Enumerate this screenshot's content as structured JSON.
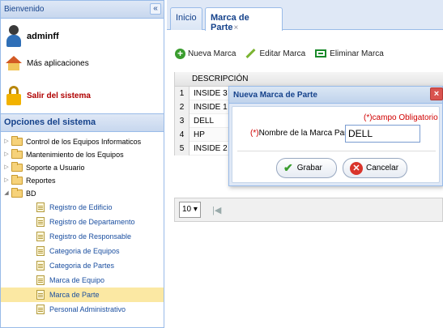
{
  "sidebar": {
    "welcome_title": "Bienvenido",
    "collapse_glyph": "«",
    "user": {
      "name": "adminff"
    },
    "more_apps": "Más aplicaciones",
    "logout": "Salir del sistema",
    "options_title": "Opciones del sistema",
    "folders": [
      "Control de los Equipos Informaticos",
      "Mantenimiento de los Equipos",
      "Soporte a Usuario",
      "Reportes",
      "BD"
    ],
    "bd_items": [
      "Registro de Edificio",
      "Registro de Departamento",
      "Registro de Responsable",
      "Categoria de Equipos",
      "Categoria de Partes",
      "Marca de Equipo",
      "Marca de Parte",
      "Personal Administrativo"
    ],
    "selected_item": "Marca de Parte"
  },
  "tabs": [
    {
      "label": "Inicio"
    },
    {
      "label": "Marca de Parte",
      "close": "×",
      "active": true
    }
  ],
  "toolbar": {
    "new_label": "Nueva Marca",
    "edit_label": "Editar Marca",
    "delete_label": "Eliminar Marca"
  },
  "grid": {
    "column": "DESCRIPCIÓN",
    "rows": [
      {
        "num": "1",
        "desc": "INSIDE 3"
      },
      {
        "num": "2",
        "desc": "INSIDE 1"
      },
      {
        "num": "3",
        "desc": "DELL"
      },
      {
        "num": "4",
        "desc": "HP"
      },
      {
        "num": "5",
        "desc": "INSIDE 2"
      }
    ],
    "page_size": "10 ▾"
  },
  "dialog": {
    "title": "Nueva Marca de Parte",
    "close_glyph": "×",
    "required_note": "(*)campo Obligatorio",
    "field_star": "(*)",
    "field_label": "Nombre de la Marca Parte:",
    "field_value": "DELL",
    "save_label": "Grabar",
    "cancel_label": "Cancelar"
  },
  "colors": {
    "header_blue": "#15428b",
    "required_red": "#d00000",
    "selected_row": "#fbe8a3"
  }
}
